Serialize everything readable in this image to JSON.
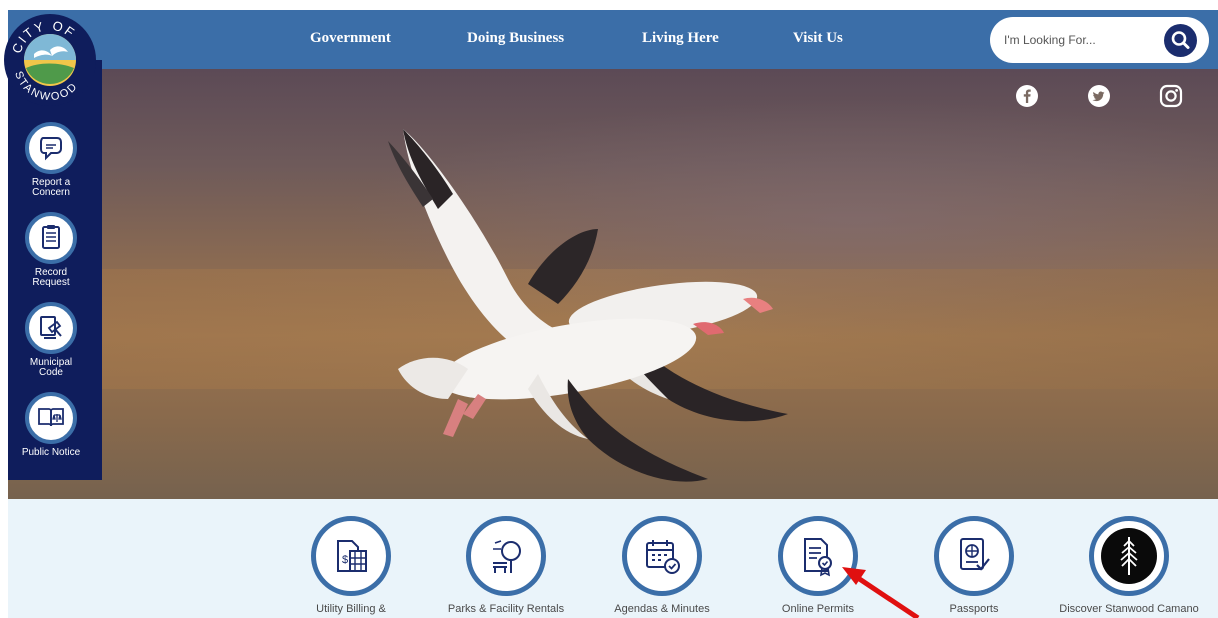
{
  "logo": {
    "text_top": "CITY OF",
    "text_bottom": "STANWOOD"
  },
  "nav": {
    "items": [
      {
        "label": "Government"
      },
      {
        "label": "Doing Business"
      },
      {
        "label": "Living Here"
      },
      {
        "label": "Visit Us"
      }
    ]
  },
  "search": {
    "placeholder": "I'm Looking For..."
  },
  "social": [
    {
      "icon": "facebook-icon"
    },
    {
      "icon": "twitter-icon"
    },
    {
      "icon": "instagram-icon"
    }
  ],
  "sidebar": {
    "items": [
      {
        "label_line1": "Report a",
        "label_line2": "Concern",
        "icon": "speech-bubble-icon"
      },
      {
        "label_line1": "Record",
        "label_line2": "Request",
        "icon": "clipboard-icon"
      },
      {
        "label_line1": "Municipal",
        "label_line2": "Code",
        "icon": "gavel-icon"
      },
      {
        "label_line1": "Public Notice",
        "label_line2": "",
        "icon": "book-scales-icon"
      }
    ]
  },
  "quick_links": [
    {
      "label": "Utility Billing &",
      "icon": "utility-billing-icon"
    },
    {
      "label": "Parks & Facility Rentals",
      "icon": "park-bench-tree-icon"
    },
    {
      "label": "Agendas & Minutes",
      "icon": "calendar-check-icon"
    },
    {
      "label": "Online Permits",
      "icon": "permit-document-icon"
    },
    {
      "label": "Passports",
      "icon": "passport-icon"
    },
    {
      "label": "Discover Stanwood Camano",
      "icon": "evergreen-tree-icon"
    }
  ],
  "colors": {
    "nav_blue": "#3b6ea8",
    "navy": "#0f1d5c",
    "quick_bg": "#eaf4fa",
    "annotation_arrow": "#e01010"
  }
}
